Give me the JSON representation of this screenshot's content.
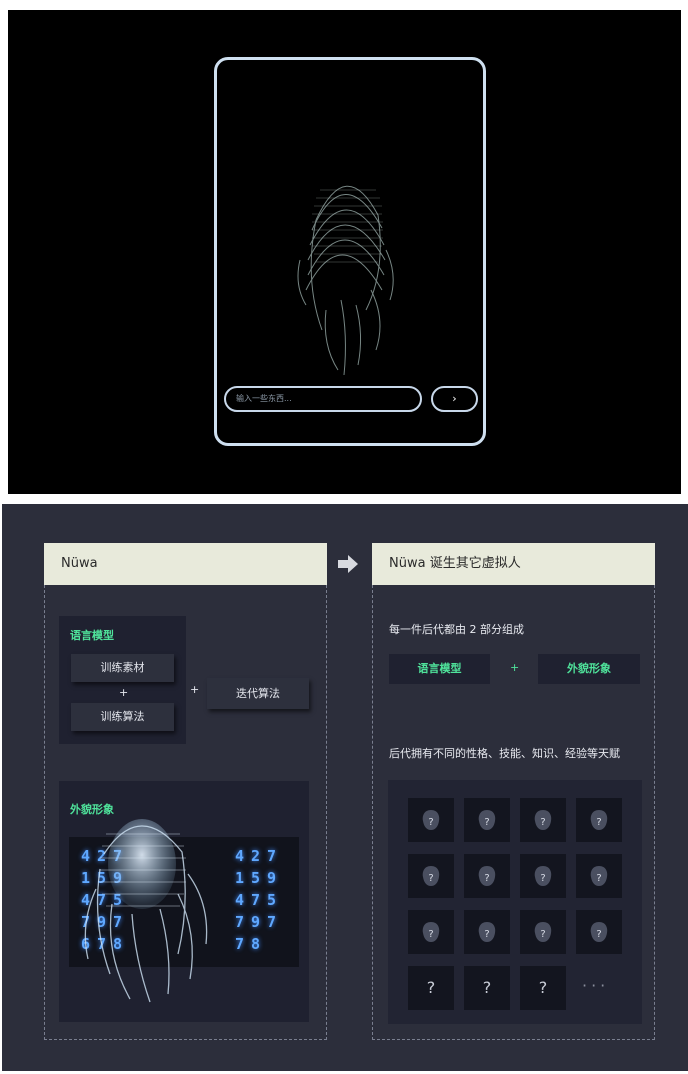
{
  "top_panel": {
    "input_placeholder": "输入一些东西...",
    "send_label": "›"
  },
  "bottom_panel": {
    "left_header": "Nüwa",
    "right_header": "Nüwa 诞生其它虚拟人",
    "language_model": {
      "title": "语言模型",
      "training_material": "训练素材",
      "plus_inner": "+",
      "training_algorithm": "训练算法",
      "plus_outer": "+",
      "iterative_algorithm": "迭代算法"
    },
    "appearance": {
      "title": "外貌形象",
      "digits_left": [
        [
          "4",
          "2",
          "7"
        ],
        [
          "1",
          "5",
          "9"
        ],
        [
          "4",
          "7",
          "5"
        ],
        [
          "7",
          "9",
          "7"
        ],
        [
          "6",
          "7",
          "8"
        ]
      ],
      "digits_right": [
        [
          "4",
          "2",
          "7"
        ],
        [
          "1",
          "5",
          "9"
        ],
        [
          "4",
          "7",
          "5"
        ],
        [
          "7",
          "9",
          "7"
        ],
        [
          "7",
          "8",
          ""
        ]
      ]
    },
    "composition_text": "每一件后代都由 2 部分组成",
    "pill_language": "语言模型",
    "pill_plus": "+",
    "pill_appearance": "外貌形象",
    "traits_text": "后代拥有不同的性格、技能、知识、经验等天赋",
    "grid_question_mark": "?",
    "grid_more": "···"
  }
}
